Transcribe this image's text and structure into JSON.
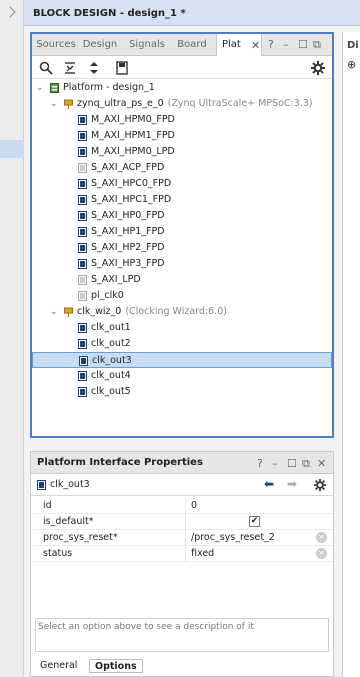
{
  "design_tab_title": "BLOCK DESIGN - design_1 *",
  "left_tabs": [
    "Sources",
    "Design",
    "Signals",
    "Board",
    "Plat"
  ],
  "right_pane_label": "Di",
  "tree": [
    {
      "label": "Platform - design_1",
      "depth": 0,
      "icon": "platform-icon",
      "twisty": "v"
    },
    {
      "label": "zynq_ultra_ps_e_0",
      "sub": "(Zynq UltraScale+ MPSoC:3.3)",
      "depth": 1,
      "icon": "ip-block-icon",
      "twisty": "v"
    },
    {
      "label": "M_AXI_HPM0_FPD",
      "depth": 2,
      "icon": "interface-icon"
    },
    {
      "label": "M_AXI_HPM1_FPD",
      "depth": 2,
      "icon": "interface-icon"
    },
    {
      "label": "M_AXI_HPM0_LPD",
      "depth": 2,
      "icon": "interface-icon"
    },
    {
      "label": "S_AXI_ACP_FPD",
      "depth": 2,
      "icon": "interface-disabled-icon"
    },
    {
      "label": "S_AXI_HPC0_FPD",
      "depth": 2,
      "icon": "interface-icon"
    },
    {
      "label": "S_AXI_HPC1_FPD",
      "depth": 2,
      "icon": "interface-icon"
    },
    {
      "label": "S_AXI_HP0_FPD",
      "depth": 2,
      "icon": "interface-icon"
    },
    {
      "label": "S_AXI_HP1_FPD",
      "depth": 2,
      "icon": "interface-icon"
    },
    {
      "label": "S_AXI_HP2_FPD",
      "depth": 2,
      "icon": "interface-icon"
    },
    {
      "label": "S_AXI_HP3_FPD",
      "depth": 2,
      "icon": "interface-icon"
    },
    {
      "label": "S_AXI_LPD",
      "depth": 2,
      "icon": "interface-disabled-icon"
    },
    {
      "label": "pl_clk0",
      "depth": 2,
      "icon": "interface-disabled-icon"
    },
    {
      "label": "clk_wiz_0",
      "sub": "(Clocking Wizard:6.0)",
      "depth": 1,
      "icon": "ip-block-icon",
      "twisty": "v"
    },
    {
      "label": "clk_out1",
      "depth": 2,
      "icon": "interface-icon"
    },
    {
      "label": "clk_out2",
      "depth": 2,
      "icon": "interface-icon"
    },
    {
      "label": "clk_out3",
      "depth": 2,
      "icon": "interface-icon",
      "selected": true
    },
    {
      "label": "clk_out4",
      "depth": 2,
      "icon": "interface-icon"
    },
    {
      "label": "clk_out5",
      "depth": 2,
      "icon": "interface-icon"
    }
  ],
  "props_panel": {
    "title": "Platform Interface Properties",
    "object_name": "clk_out3",
    "rows": [
      {
        "key": "id",
        "value": "0"
      },
      {
        "key": "is_default*",
        "value": "",
        "checkbox": true,
        "checked": true
      },
      {
        "key": "proc_sys_reset*",
        "value": "/proc_sys_reset_2",
        "clearable": true
      },
      {
        "key": "status",
        "value": "fixed",
        "clearable": true
      }
    ],
    "description": "Select an option above to see a description of it",
    "tabs": [
      "General",
      "Options"
    ],
    "active_tab": "Options"
  },
  "colors": {
    "accent": "#4f7fc0",
    "selection": "#c8dcf4",
    "header": "#d6e2f3"
  }
}
